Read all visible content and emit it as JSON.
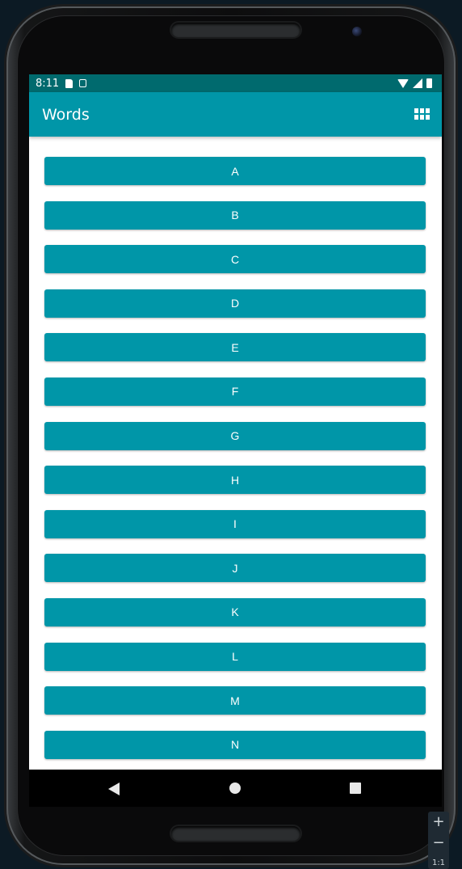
{
  "status_bar": {
    "time": "8:11"
  },
  "app_bar": {
    "title": "Words"
  },
  "letters": [
    "A",
    "B",
    "C",
    "D",
    "E",
    "F",
    "G",
    "H",
    "I",
    "J",
    "K",
    "L",
    "M",
    "N"
  ],
  "zoom": {
    "plus": "+",
    "minus": "−",
    "ratio": "1:1"
  },
  "colors": {
    "accent": "#0096a8",
    "status_bar": "#006a6e"
  },
  "icons": {
    "status": [
      "sd-card-icon",
      "calendar-icon",
      "wifi-icon",
      "signal-icon",
      "battery-icon"
    ],
    "app_bar_action": "grid-layout-icon",
    "nav": [
      "back-icon",
      "home-icon",
      "recents-icon"
    ]
  }
}
